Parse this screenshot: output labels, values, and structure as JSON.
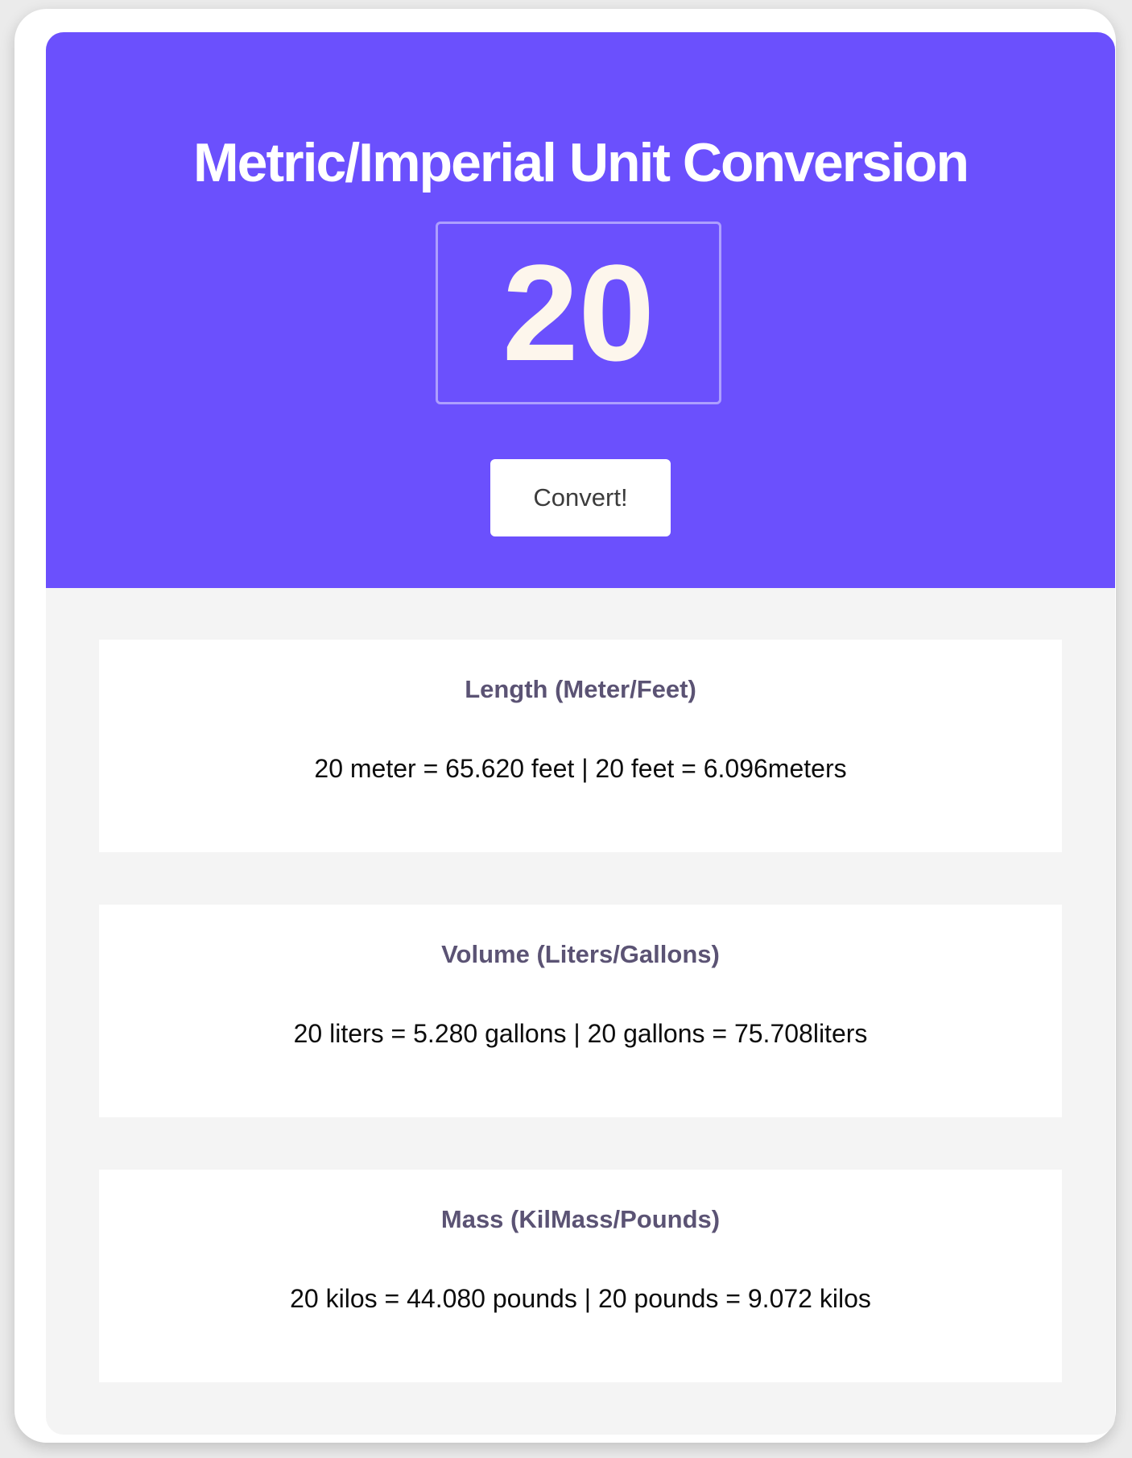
{
  "header": {
    "title": "Metric/Imperial Unit Conversion",
    "input_value": "20",
    "convert_label": "Convert!"
  },
  "colors": {
    "accent": "#6b50fd",
    "heading": "#5b5374"
  },
  "results": {
    "length": {
      "heading": "Length (Meter/Feet)",
      "text": "20 meter = 65.620 feet | 20 feet = 6.096meters"
    },
    "volume": {
      "heading": "Volume (Liters/Gallons)",
      "text": "20 liters = 5.280 gallons | 20 gallons = 75.708liters"
    },
    "mass": {
      "heading": "Mass (KilMass/Pounds)",
      "text": "20 kilos = 44.080 pounds | 20 pounds = 9.072 kilos"
    }
  }
}
